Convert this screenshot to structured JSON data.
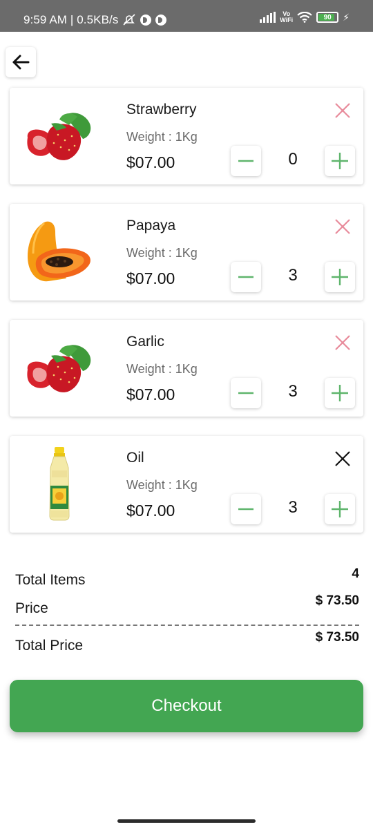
{
  "status_bar": {
    "time_network": "9:59 AM | 0.5KB/s",
    "vowifi_line1": "Vo",
    "vowifi_line2": "WiFi",
    "battery_level": "90"
  },
  "cart": {
    "items": [
      {
        "name": "Strawberry",
        "weight": "Weight : 1Kg",
        "price": "$07.00",
        "quantity": "0",
        "image_icon": "strawberry-icon",
        "remove_color": "#e88a9a"
      },
      {
        "name": "Papaya",
        "weight": "Weight : 1Kg",
        "price": "$07.00",
        "quantity": "3",
        "image_icon": "papaya-icon",
        "remove_color": "#e88a9a"
      },
      {
        "name": "Garlic",
        "weight": "Weight : 1Kg",
        "price": "$07.00",
        "quantity": "3",
        "image_icon": "strawberry-icon",
        "remove_color": "#e88a9a"
      },
      {
        "name": "Oil",
        "weight": "Weight : 1Kg",
        "price": "$07.00",
        "quantity": "3",
        "image_icon": "oil-bottle-icon",
        "remove_color": "#111111"
      }
    ]
  },
  "summary": {
    "total_items_label": "Total Items",
    "total_items_value": "4",
    "price_label": "Price",
    "price_value": "$ 73.50",
    "total_price_label": "Total Price",
    "total_price_value": "$ 73.50"
  },
  "checkout": {
    "label": "Checkout"
  },
  "colors": {
    "accent_green": "#43a652",
    "stepper_green": "#5fb56c",
    "remove_pink": "#e88a9a"
  }
}
